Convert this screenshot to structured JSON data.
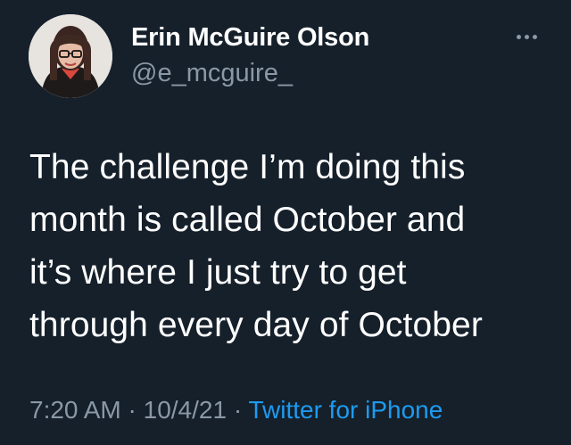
{
  "author": {
    "display_name": "Erin McGuire Olson",
    "handle": "@e_mcguire_"
  },
  "tweet": {
    "lines": [
      "The challenge I’m doing this",
      "month is called October and",
      "it’s where I just try to get",
      "through every day of October"
    ]
  },
  "meta": {
    "time": "7:20 AM",
    "separator_1": " · ",
    "date": "10/4/21",
    "separator_2": " · ",
    "source": "Twitter for iPhone"
  },
  "icons": {
    "more": "more-horizontal-icon"
  },
  "colors": {
    "background": "#15202b",
    "text": "#ffffff",
    "secondary_text": "#8b98a5",
    "link": "#1d9bf0"
  }
}
